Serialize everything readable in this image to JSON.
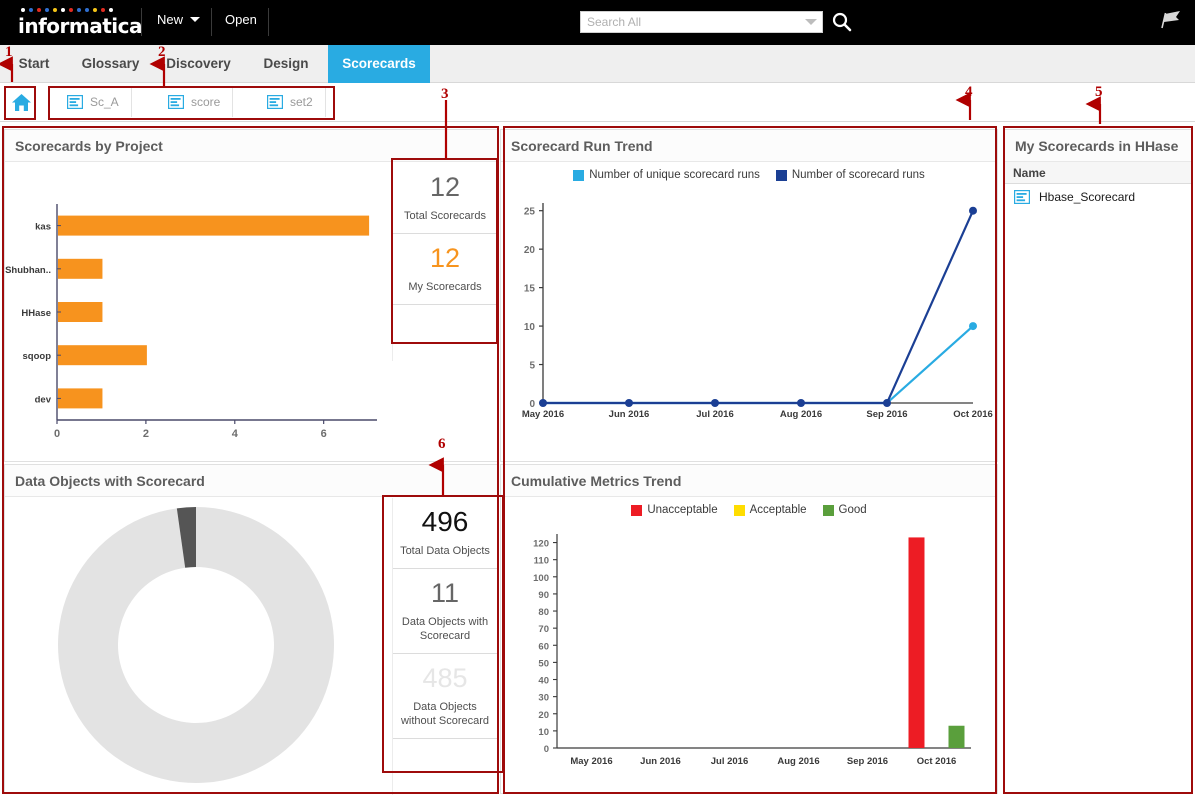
{
  "header": {
    "brand": "informatica",
    "logo_dot_colors": [
      "#ffffff",
      "#2f6fd0",
      "#e02b20",
      "#2f6fd0",
      "#f5c518",
      "#ffffff",
      "#e02b20",
      "#2f6fd0",
      "#2f6fd0",
      "#f5c518",
      "#e02b20",
      "#ffffff"
    ],
    "menu_new": "New",
    "menu_open": "Open",
    "search_placeholder": "Search All",
    "search_value": "",
    "search_icon": "search-icon",
    "flag_icon": "flag-icon"
  },
  "nav": {
    "tabs": [
      {
        "label": "Start",
        "active": false
      },
      {
        "label": "Glossary",
        "active": false
      },
      {
        "label": "Discovery",
        "active": false
      },
      {
        "label": "Design",
        "active": false
      },
      {
        "label": "Scorecards",
        "active": true
      }
    ]
  },
  "subbar": {
    "home_icon": "home-icon",
    "chips": [
      {
        "label": "Sc_A",
        "icon": "scorecard-icon"
      },
      {
        "label": "score",
        "icon": "scorecard-icon"
      },
      {
        "label": "set2",
        "icon": "scorecard-icon"
      }
    ]
  },
  "panels": {
    "scorecards_by_project": {
      "title": "Scorecards by Project",
      "kpis": [
        {
          "value": "12",
          "label": "Total Scorecards",
          "style": "gray"
        },
        {
          "value": "12",
          "label": "My Scorecards",
          "style": "orange"
        }
      ]
    },
    "scorecard_run_trend": {
      "title": "Scorecard Run Trend"
    },
    "data_objects_with_scorecard": {
      "title": "Data Objects with Scorecard",
      "kpis": [
        {
          "value": "496",
          "label": "Total Data Objects",
          "style": "black"
        },
        {
          "value": "11",
          "label": "Data Objects with Scorecard",
          "style": "gray"
        },
        {
          "value": "485",
          "label": "Data Objects without Scorecard",
          "style": "faded"
        }
      ]
    },
    "cumulative_metrics_trend": {
      "title": "Cumulative Metrics Trend"
    },
    "my_scorecards": {
      "title": "My Scorecards in HHase",
      "column_header": "Name",
      "rows": [
        {
          "name": "Hbase_Scorecard",
          "icon": "scorecard-icon"
        }
      ]
    }
  },
  "annotations": [
    {
      "number": "1"
    },
    {
      "number": "2"
    },
    {
      "number": "3"
    },
    {
      "number": "4"
    },
    {
      "number": "5"
    },
    {
      "number": "6"
    }
  ],
  "chart_data": [
    {
      "id": "scorecards_by_project",
      "type": "bar",
      "orientation": "horizontal",
      "title": "Scorecards by Project",
      "categories": [
        "kas",
        "Shubhan..",
        "HHase",
        "sqoop",
        "dev"
      ],
      "values": [
        7,
        1,
        1,
        2,
        1
      ],
      "xlabel": "",
      "ylabel": "",
      "xlim": [
        0,
        7.2
      ],
      "xticks": [
        0,
        2,
        4,
        6
      ],
      "color": "#f7931e",
      "grid": false,
      "legend": "none"
    },
    {
      "id": "scorecard_run_trend",
      "type": "line",
      "title": "Scorecard Run Trend",
      "categories": [
        "May 2016",
        "Jun 2016",
        "Jul 2016",
        "Aug 2016",
        "Sep 2016",
        "Oct 2016"
      ],
      "series": [
        {
          "name": "Number of unique scorecard runs",
          "values": [
            0,
            0,
            0,
            0,
            0,
            10
          ],
          "color": "#29abe2"
        },
        {
          "name": "Number of scorecard runs",
          "values": [
            0,
            0,
            0,
            0,
            0,
            25
          ],
          "color": "#1b3f94"
        }
      ],
      "ylim": [
        0,
        26
      ],
      "yticks": [
        0,
        5,
        10,
        15,
        20,
        25
      ],
      "xlabel": "",
      "ylabel": "",
      "grid": false,
      "legend": "top"
    },
    {
      "id": "data_objects_with_scorecard",
      "type": "pie",
      "subtype": "donut",
      "title": "Data Objects with Scorecard",
      "labels": [
        "Data Objects without Scorecard",
        "Data Objects with Scorecard"
      ],
      "values": [
        485,
        11
      ],
      "colors": [
        "#e3e3e3",
        "#555555"
      ],
      "legend": "none"
    },
    {
      "id": "cumulative_metrics_trend",
      "type": "bar",
      "orientation": "vertical",
      "title": "Cumulative Metrics Trend",
      "categories": [
        "May 2016",
        "Jun 2016",
        "Jul 2016",
        "Aug 2016",
        "Sep 2016",
        "Oct 2016"
      ],
      "series": [
        {
          "name": "Unacceptable",
          "values": [
            0,
            0,
            0,
            0,
            0,
            123
          ],
          "color": "#ed1c24"
        },
        {
          "name": "Acceptable",
          "values": [
            0,
            0,
            0,
            0,
            0,
            0
          ],
          "color": "#ffdd00"
        },
        {
          "name": "Good",
          "values": [
            0,
            0,
            0,
            0,
            0,
            13
          ],
          "color": "#5a9f3c"
        }
      ],
      "ylim": [
        0,
        125
      ],
      "yticks": [
        0,
        10,
        20,
        30,
        40,
        50,
        60,
        70,
        80,
        90,
        100,
        110,
        120
      ],
      "xlabel": "",
      "ylabel": "",
      "grid": false,
      "legend": "top"
    }
  ]
}
